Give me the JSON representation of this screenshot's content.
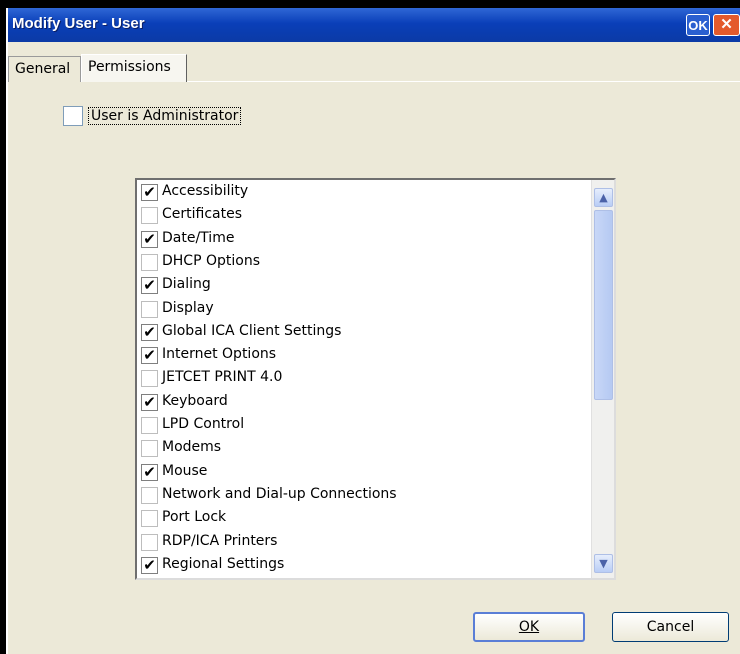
{
  "window": {
    "title": "Modify User - User",
    "ok_label": "OK",
    "close_label": "✕"
  },
  "tabs": [
    {
      "label": "General",
      "active": false
    },
    {
      "label": "Permissions",
      "active": true
    }
  ],
  "admin": {
    "label": "User is Administrator",
    "checked": false
  },
  "permissions": [
    {
      "label": "Accessibility",
      "checked": true
    },
    {
      "label": "Certificates",
      "checked": false
    },
    {
      "label": "Date/Time",
      "checked": true
    },
    {
      "label": "DHCP Options",
      "checked": false
    },
    {
      "label": "Dialing",
      "checked": true
    },
    {
      "label": "Display",
      "checked": false
    },
    {
      "label": "Global ICA Client Settings",
      "checked": true
    },
    {
      "label": "Internet Options",
      "checked": true
    },
    {
      "label": "JETCET PRINT 4.0",
      "checked": false
    },
    {
      "label": "Keyboard",
      "checked": true
    },
    {
      "label": "LPD Control",
      "checked": false
    },
    {
      "label": "Modems",
      "checked": false
    },
    {
      "label": "Mouse",
      "checked": true
    },
    {
      "label": "Network and Dial-up Connections",
      "checked": false
    },
    {
      "label": "Port Lock",
      "checked": false
    },
    {
      "label": "RDP/ICA Printers",
      "checked": false
    },
    {
      "label": "Regional Settings",
      "checked": true
    }
  ],
  "buttons": {
    "ok_label": "OK",
    "cancel_label": "Cancel"
  },
  "icons": {
    "check": "✔",
    "scroll_up": "▲",
    "scroll_down": "▼"
  }
}
